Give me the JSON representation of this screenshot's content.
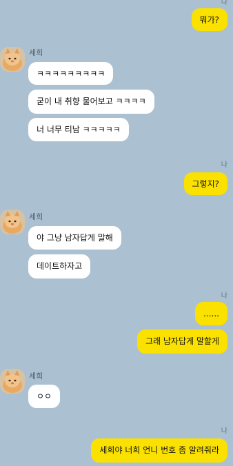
{
  "chat": {
    "me_label": "나",
    "sender_name": "세희",
    "messages": [
      {
        "from": "me",
        "text": "뭐가?"
      },
      {
        "from": "them",
        "text": "ㅋㅋㅋㅋㅋㅋㅋㅋㅋ"
      },
      {
        "from": "them",
        "text": "굳이 내 취향 물어보고 ㅋㅋㅋㅋ"
      },
      {
        "from": "them",
        "text": "너 너무 티남 ㅋㅋㅋㅋㅋ"
      },
      {
        "from": "me",
        "text": "그렇지?"
      },
      {
        "from": "them",
        "text": "야 그냥 남자답게 말해"
      },
      {
        "from": "them",
        "text": "데이트하자고"
      },
      {
        "from": "me",
        "text": "......"
      },
      {
        "from": "me",
        "text": "그래 남자답게 말할게"
      },
      {
        "from": "them",
        "text": "ㅇㅇ"
      },
      {
        "from": "me",
        "text": "세희야 너희 언니 번호 좀 알려줘라"
      }
    ]
  },
  "colors": {
    "background": "#abc1d1",
    "my_bubble": "#fae100",
    "their_bubble": "#ffffff"
  },
  "icons": {
    "avatar": "cat-avatar-icon"
  }
}
